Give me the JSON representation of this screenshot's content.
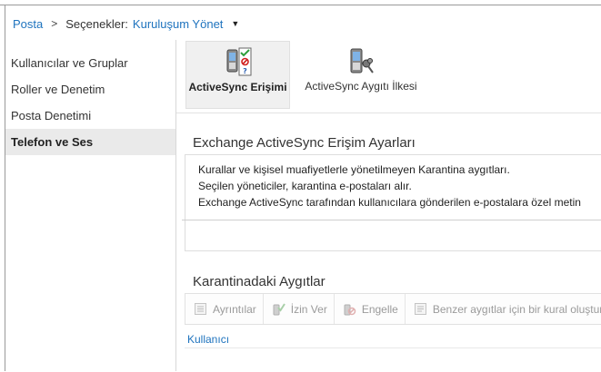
{
  "breadcrumb": {
    "root": "Posta",
    "options_label": "Seçenekler:",
    "current": "Kuruluşum Yönet",
    "separator": ">"
  },
  "left_nav": {
    "items": [
      {
        "label": "Kullanıcılar ve Gruplar",
        "selected": false
      },
      {
        "label": "Roller ve Denetim",
        "selected": false
      },
      {
        "label": "Posta Denetimi",
        "selected": false
      },
      {
        "label": "Telefon ve Ses",
        "selected": true
      }
    ]
  },
  "tabs": [
    {
      "label": "ActiveSync Erişimi",
      "icon": "phone-access-icon",
      "active": true
    },
    {
      "label": "ActiveSync Aygıtı İlkesi",
      "icon": "phone-policy-icon",
      "active": false
    }
  ],
  "access_settings": {
    "title": "Exchange ActiveSync Erişim Ayarları",
    "lines": [
      "Kurallar ve kişisel muafiyetlerle yönetilmeyen Karantina aygıtları.",
      "Seçilen yöneticiler, karantina e-postaları alır.",
      "Exchange ActiveSync tarafından kullanıcılara gönderilen e-postalara özel metin"
    ]
  },
  "quarantine": {
    "title": "Karantinadaki Aygıtlar",
    "toolbar": {
      "details": "Ayrıntılar",
      "allow": "İzin Ver",
      "block": "Engelle",
      "rule": "Benzer aygıtlar için bir kural oluştur"
    },
    "column_user": "Kullanıcı"
  },
  "colors": {
    "link": "#1e73be",
    "selected_bg": "#eaeaea",
    "disabled_text": "#9a9a9a"
  }
}
